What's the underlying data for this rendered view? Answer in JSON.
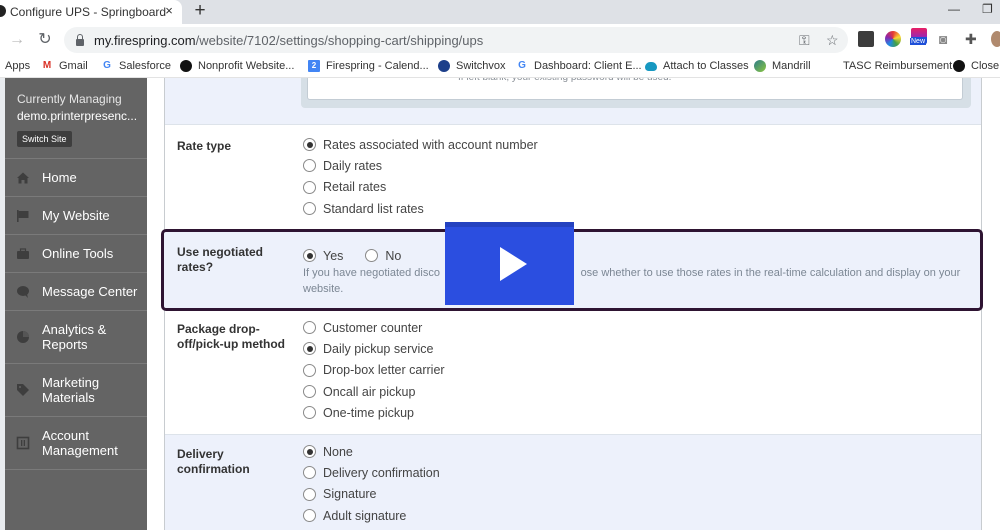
{
  "browser": {
    "tab_title": "Configure UPS - Springboard",
    "tab_close": "×",
    "new_tab": "+",
    "window_minimize": "—",
    "window_restore": "❐",
    "url_host": "my.firespring.com",
    "url_path": "/website/7102/settings/shopping-cart/shipping/ups",
    "extension_badge": "New",
    "bookmarks": [
      {
        "label": "Apps",
        "icon": "apps-icon"
      },
      {
        "label": "Gmail",
        "icon": "gmail-icon"
      },
      {
        "label": "Salesforce",
        "icon": "google-icon"
      },
      {
        "label": "Nonprofit Website...",
        "icon": "firespring-icon"
      },
      {
        "label": "Firespring - Calend...",
        "icon": "calendar-icon"
      },
      {
        "label": "Switchvox",
        "icon": "switchvox-icon"
      },
      {
        "label": "Dashboard: Client E...",
        "icon": "google-icon"
      },
      {
        "label": "Attach to Classes",
        "icon": "salesforce-cloud-icon"
      },
      {
        "label": "Mandrill",
        "icon": "mandrill-icon"
      },
      {
        "label": "TASC Reimbursement",
        "icon": ""
      },
      {
        "label": "Close",
        "icon": "firespring-icon"
      }
    ]
  },
  "sidebar": {
    "managing_label": "Currently Managing",
    "managing_site": "demo.printerpresenc...",
    "switch_site": "Switch Site",
    "items": [
      {
        "label": "Home",
        "icon": "home-icon"
      },
      {
        "label": "My Website",
        "icon": "flag-icon"
      },
      {
        "label": "Online Tools",
        "icon": "toolbox-icon"
      },
      {
        "label": "Message Center",
        "icon": "chat-bubble-icon"
      },
      {
        "label": "Analytics & Reports",
        "icon": "pie-chart-icon"
      },
      {
        "label": "Marketing Materials",
        "icon": "tag-icon"
      },
      {
        "label": "Account Management",
        "icon": "account-icon"
      }
    ]
  },
  "form": {
    "password_hint": "If left blank, your existing password will be used.",
    "rate_type": {
      "label": "Rate type",
      "options": [
        "Rates associated with account number",
        "Daily rates",
        "Retail rates",
        "Standard list rates"
      ],
      "selected": 0
    },
    "negotiated": {
      "label": "Use negotiated rates?",
      "options": [
        "Yes",
        "No"
      ],
      "selected": 0,
      "help": "If you have negotiated disco                                              ose whether to use those rates in the real-time calculation and display on your website."
    },
    "package_method": {
      "label": "Package drop-off/pick-up method",
      "options": [
        "Customer counter",
        "Daily pickup service",
        "Drop-box letter carrier",
        "Oncall air pickup",
        "One-time pickup"
      ],
      "selected": 1
    },
    "delivery_confirmation": {
      "label": "Delivery confirmation",
      "options": [
        "None",
        "Delivery confirmation",
        "Signature",
        "Adult signature"
      ],
      "selected": 0
    }
  },
  "video": {
    "play_label": "Play video"
  },
  "colors": {
    "sidebar_bg": "#646464",
    "section_alt_bg": "#edf1fb",
    "highlight_border": "#2e1432",
    "play_button": "#2b4ee0"
  }
}
